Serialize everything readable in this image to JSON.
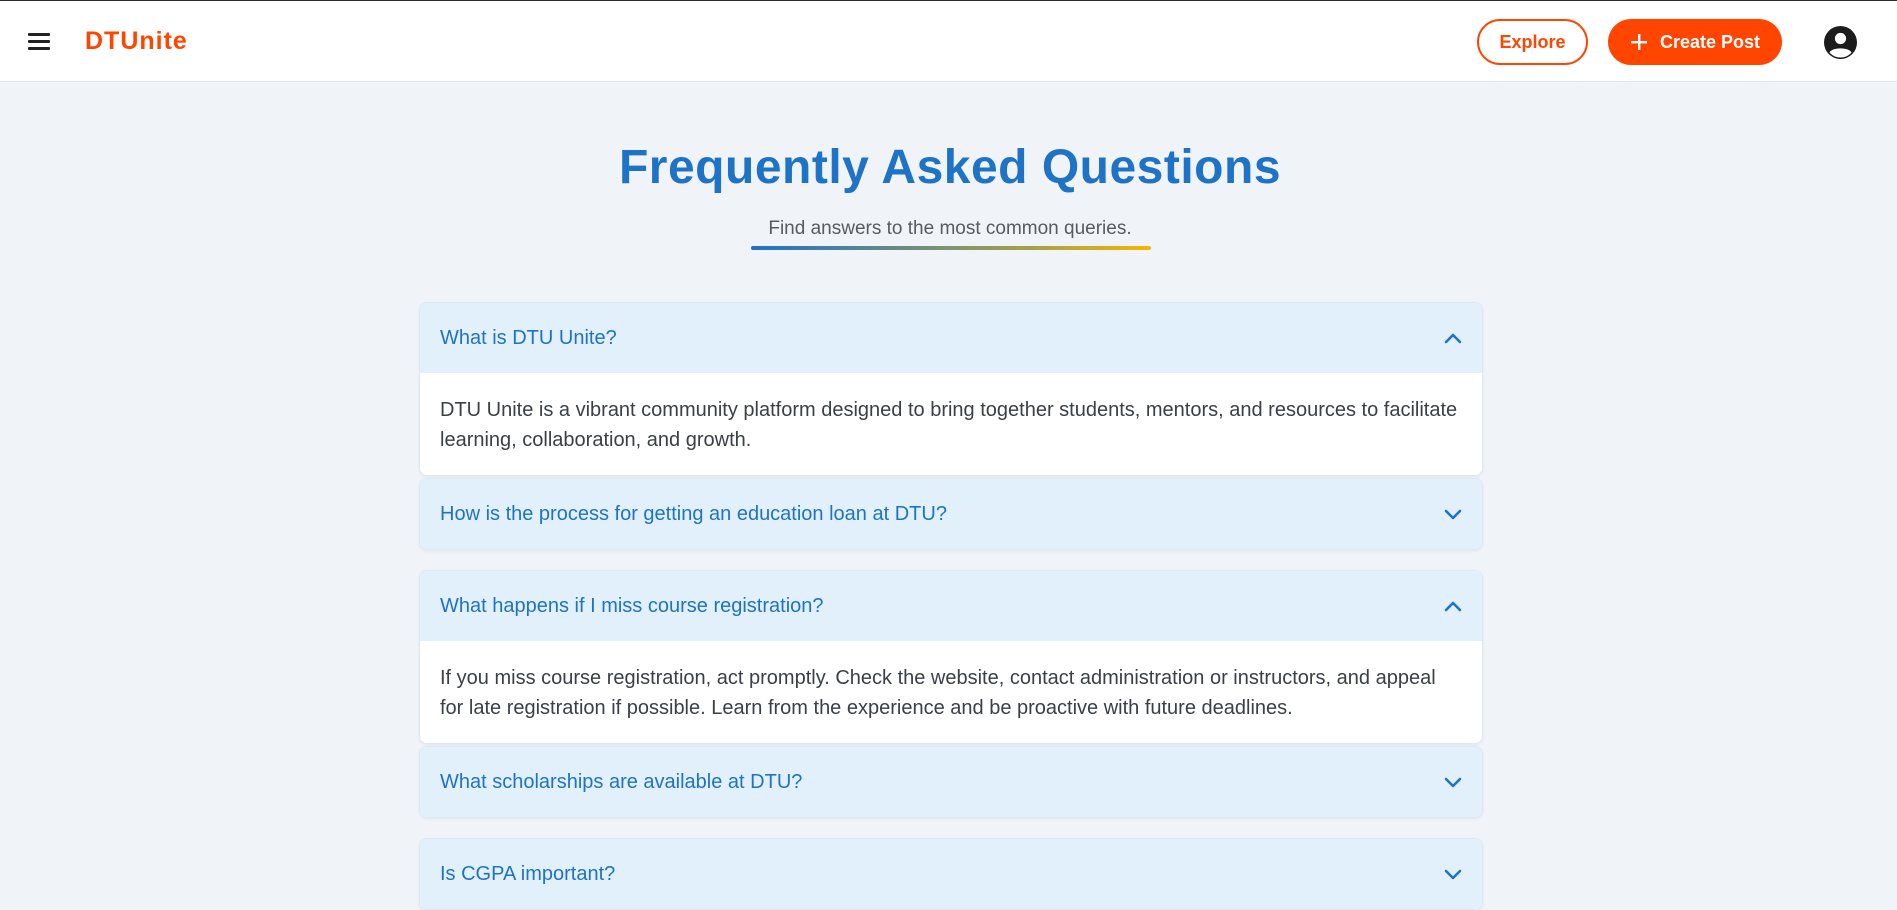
{
  "header": {
    "brand": "DTUnite",
    "explore_label": "Explore",
    "create_post_label": "Create Post",
    "icons": {
      "menu": "menu-icon",
      "plus": "plus-icon",
      "profile": "account-circle-icon"
    },
    "brand_color": "#ff4500"
  },
  "hero": {
    "title": "Frequently Asked Questions",
    "subtitle": "Find answers to the most common queries.",
    "title_color": "#1e73c6"
  },
  "faqs": [
    {
      "question": "What is DTU Unite?",
      "expanded": true,
      "answer": "DTU Unite is a vibrant community platform designed to bring together students, mentors, and resources to facilitate learning, collaboration, and growth."
    },
    {
      "question": "How is the process for getting an education loan at DTU?",
      "expanded": false
    },
    {
      "question": "What happens if I miss course registration?",
      "expanded": true,
      "answer": "If you miss course registration, act promptly. Check the website, contact administration or instructors, and appeal for late registration if possible. Learn from the experience and be proactive with future deadlines."
    },
    {
      "question": "What scholarships are available at DTU?",
      "expanded": false
    },
    {
      "question": "Is CGPA important?",
      "expanded": false
    }
  ]
}
